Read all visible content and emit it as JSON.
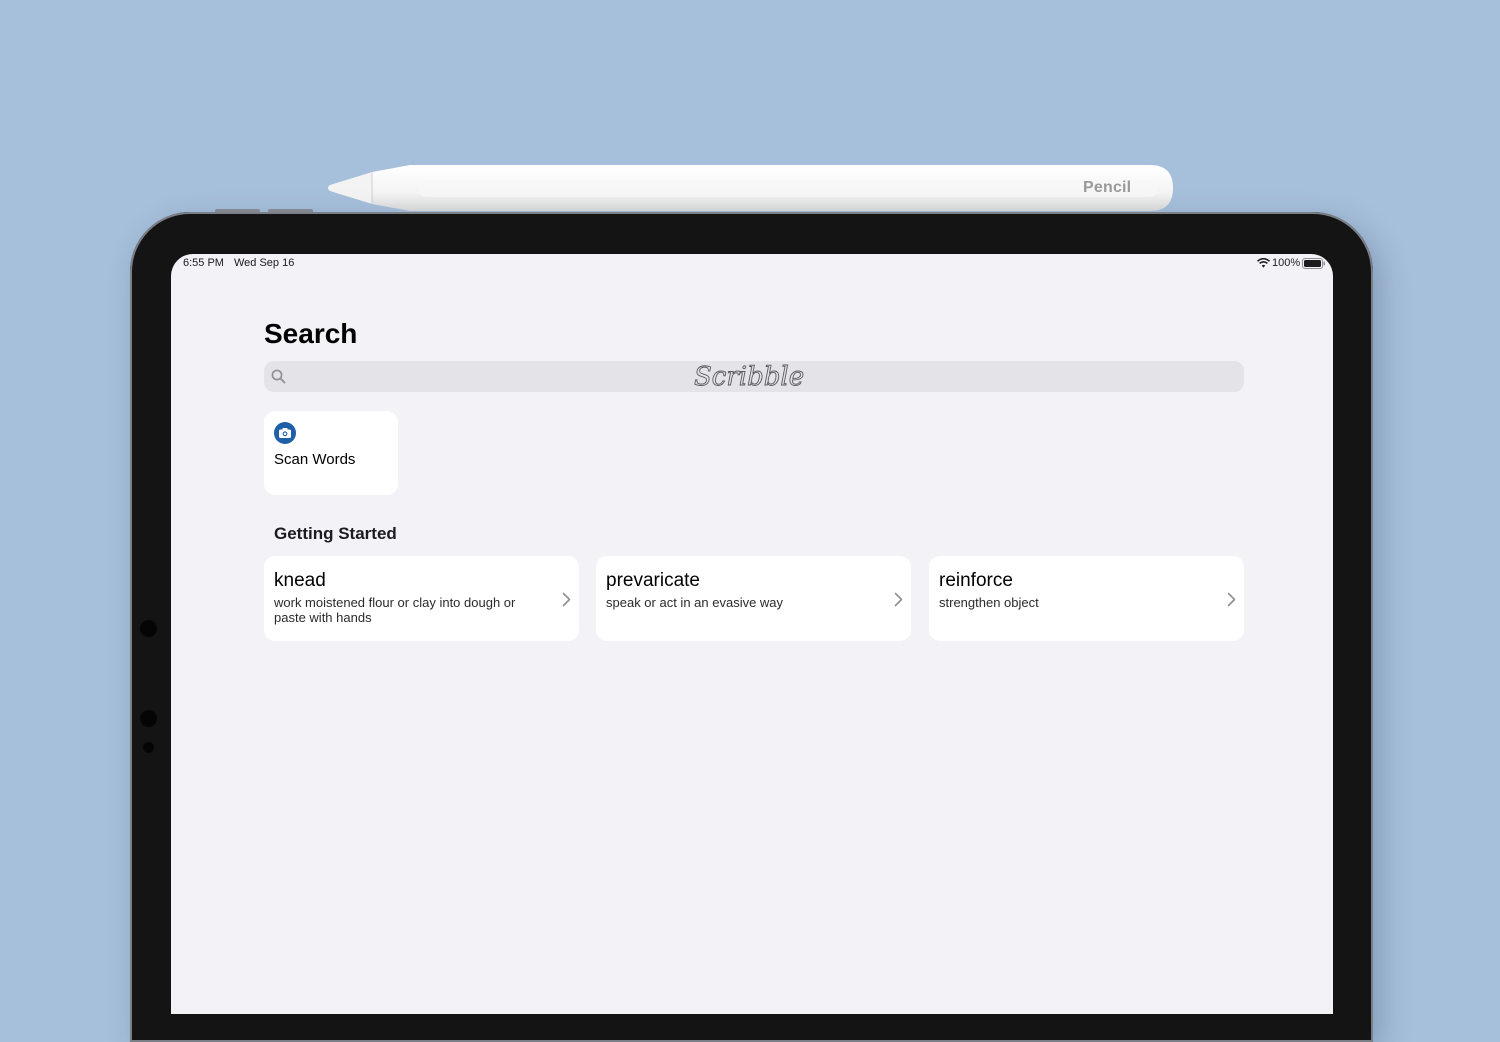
{
  "pencil": {
    "label": "Pencil"
  },
  "status_bar": {
    "time": "6:55 PM",
    "date": "Wed Sep 16",
    "battery": "100%"
  },
  "page": {
    "title": "Search"
  },
  "search": {
    "scribble": "Scribble"
  },
  "scan_card": {
    "label": "Scan Words",
    "icon": "camera-icon"
  },
  "section": {
    "title": "Getting Started"
  },
  "words": [
    {
      "word": "knead",
      "definition": "work moistened flour or clay into dough or paste with hands"
    },
    {
      "word": "prevaricate",
      "definition": "speak or act in an evasive way"
    },
    {
      "word": "reinforce",
      "definition": "strengthen object"
    }
  ],
  "colors": {
    "background": "#a6bfdb",
    "screen": "#f2f2f7",
    "accent": "#1e5fa8"
  }
}
